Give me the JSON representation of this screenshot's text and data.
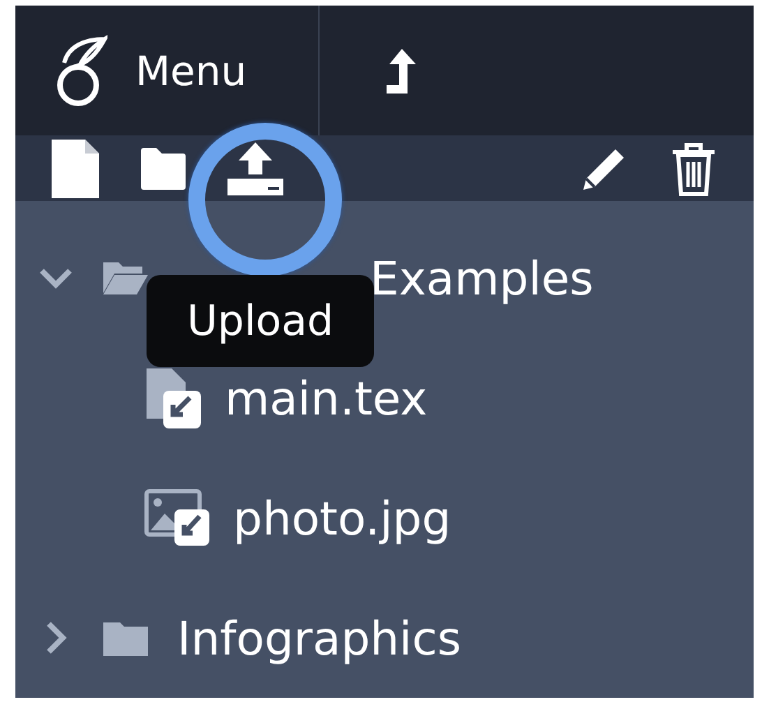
{
  "header": {
    "menu_label": "Menu"
  },
  "toolbar": {
    "tooltip": "Upload"
  },
  "tree": [
    {
      "kind": "folder",
      "name": "Examples",
      "expanded": true,
      "children": [
        {
          "kind": "file",
          "name": "main.tex"
        },
        {
          "kind": "image",
          "name": "photo.jpg"
        }
      ]
    },
    {
      "kind": "folder",
      "name": "Infographics",
      "expanded": false
    }
  ]
}
